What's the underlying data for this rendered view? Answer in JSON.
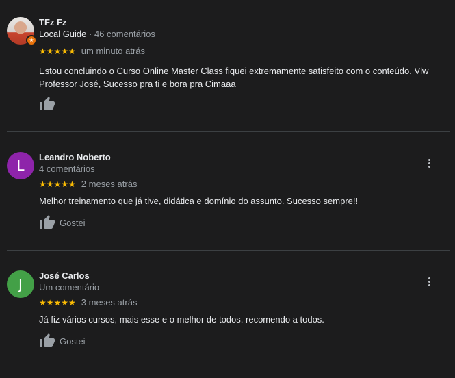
{
  "reviews": [
    {
      "author": "TFz Fz",
      "guide_label": "Local Guide",
      "meta": " · 46 comentários",
      "stars": "★★★★★",
      "rating": 5,
      "time": "um minuto atrás",
      "text": "Estou concluindo o Curso Online Master Class fiquei extremamente satisfeito com o conteúdo.  Vlw Professor José, Sucesso pra ti e bora pra Cimaaa",
      "like_label": "",
      "avatar_icon": "user-photo-icon",
      "badge_icon": "local-guide-star-icon",
      "badge_glyph": "★"
    },
    {
      "author": "Leandro Noberto",
      "meta": "4 comentários",
      "avatar_letter": "L",
      "avatar_color": "#8e24aa",
      "stars": "★★★★★",
      "rating": 5,
      "time": "2 meses atrás",
      "text": "Melhor treinamento que já tive, didática e domínio do assunto. Sucesso sempre!!",
      "like_label": "Gostei"
    },
    {
      "author": "José Carlos",
      "meta": "Um comentário",
      "avatar_letter": "J",
      "avatar_color": "#43a047",
      "stars": "★★★★★",
      "rating": 5,
      "time": "3 meses atrás",
      "text": "Já fiz vários cursos, mais esse e o melhor de todos, recomendo a todos.",
      "like_label": "Gostei"
    }
  ],
  "colors": {
    "background": "#1c1c1d",
    "star": "#fbbc04",
    "secondary_text": "#9aa0a6",
    "divider": "#3c4043"
  },
  "icons": {
    "like": "thumbs-up-icon",
    "menu": "more-vert-icon"
  }
}
